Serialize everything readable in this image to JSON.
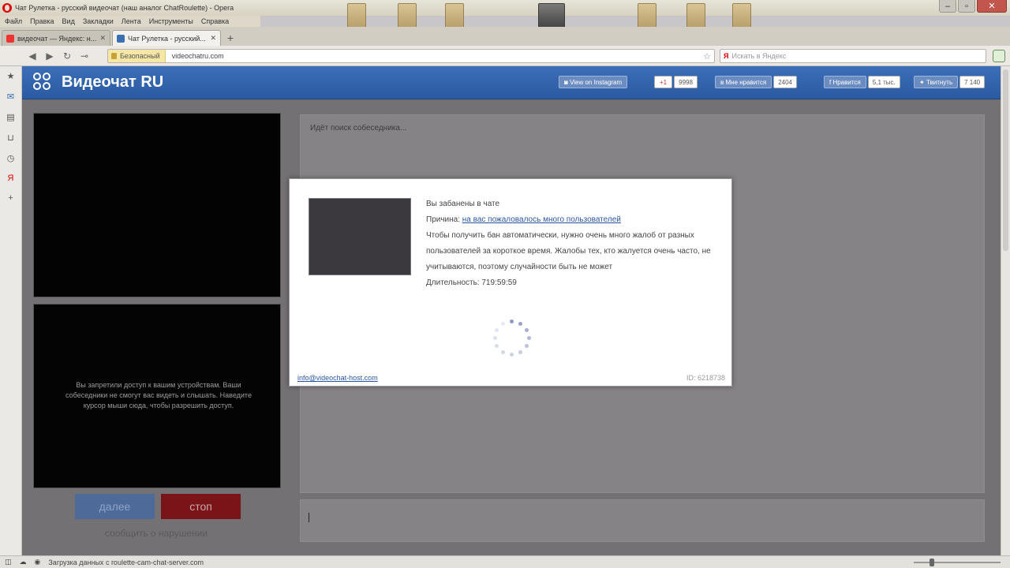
{
  "window": {
    "title": "Чат Рулетка - русский видеочат (наш аналог ChatRoulette) - Opera",
    "menu": [
      "Файл",
      "Правка",
      "Вид",
      "Закладки",
      "Лента",
      "Инструменты",
      "Справка"
    ]
  },
  "tabs": [
    {
      "label": "видеочат — Яндекс: н...",
      "active": false
    },
    {
      "label": "Чат Рулетка - русский...",
      "active": true
    }
  ],
  "address_bar": {
    "security_label": "Безопасный",
    "url": "videochatru.com",
    "search_placeholder": "Искать в Яндекс"
  },
  "site": {
    "logo_text": "Видеочат RU",
    "share": {
      "instagram_label": "View on Instagram",
      "gplus_label": "+1",
      "gplus_count": "9998",
      "vk_label": "Мне нравится",
      "vk_count": "2404",
      "fb_label": "Нравится",
      "fb_count": "5,1 тыс.",
      "tw_label": "Твитнуть",
      "tw_count": "7 140"
    }
  },
  "left_panel": {
    "access_message": "Вы запретили доступ к вашим устройствам. Ваши собеседники не смогут вас видеть и слышать. Наведите курсор мыши сюда, чтобы разрешить доступ.",
    "next_button": "далее",
    "stop_button": "стоп",
    "report_link": "сообщить о нарушении"
  },
  "chat": {
    "status": "Идёт поиск собеседника..."
  },
  "modal": {
    "line1": "Вы забанены в чате",
    "reason_label": "Причина:",
    "reason_link": "на вас пожаловалось много пользователей",
    "line3": "Чтобы получить бан автоматически, нужно очень много жалоб от разных пользователей за короткое время. Жалобы тех, кто жалуется очень часто, не учитываются, поэтому случайности быть не может",
    "duration": "Длительность: 719:59:59",
    "email": "info@videochat-host.com",
    "id": "ID: 6218738"
  },
  "status_bar": {
    "text": "Загрузка данных с roulette-cam-chat-server.com"
  },
  "icons": {
    "sidebar": [
      "star-icon",
      "mail-icon",
      "notes-icon",
      "transfers-icon",
      "history-icon",
      "yandex-icon",
      "plus-icon"
    ]
  }
}
